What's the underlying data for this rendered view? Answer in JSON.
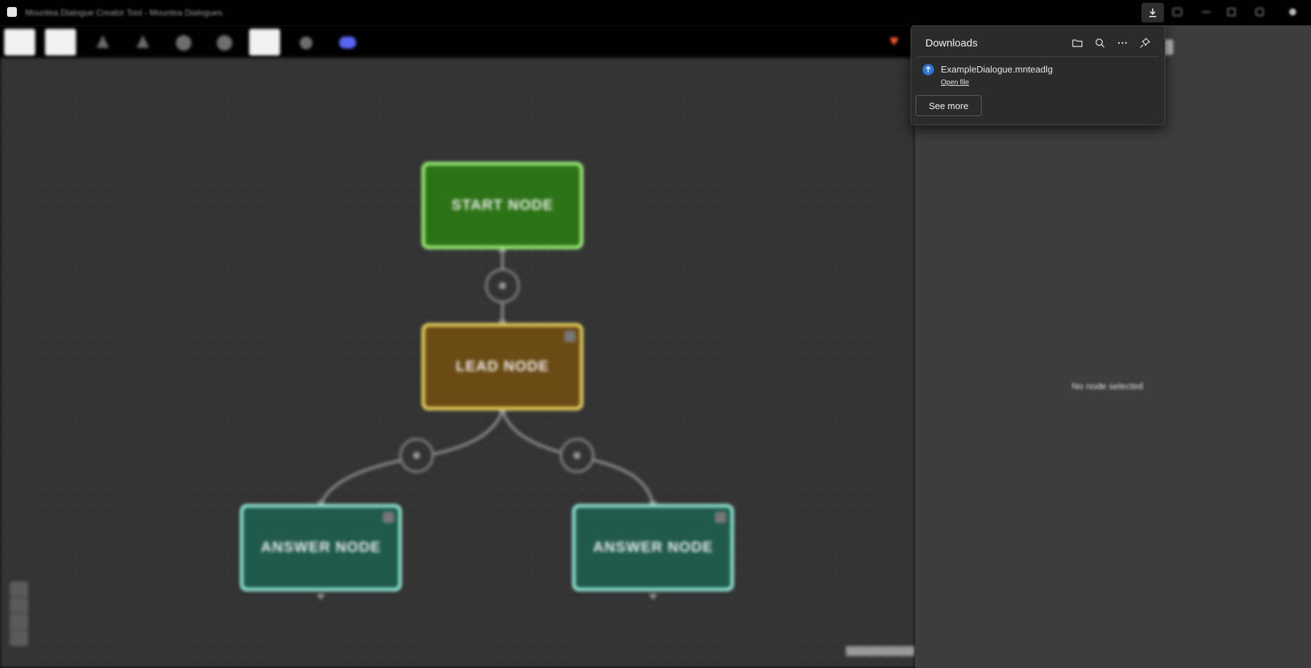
{
  "window": {
    "title": "Mountea Dialogue Creator Tool - Mountea Dialogues"
  },
  "downloads": {
    "title": "Downloads",
    "items": [
      {
        "filename": "ExampleDialogue.mnteadlg",
        "action_label": "Open file"
      }
    ],
    "see_more_label": "See more",
    "header_icons": [
      "folder-icon",
      "search-icon",
      "more-icon",
      "pin-icon"
    ]
  },
  "graph": {
    "nodes": [
      {
        "id": "start",
        "label": "START NODE"
      },
      {
        "id": "lead",
        "label": "LEAD NODE"
      },
      {
        "id": "answer-1",
        "label": "ANSWER NODE"
      },
      {
        "id": "answer-2",
        "label": "ANSWER NODE"
      }
    ]
  },
  "properties_panel": {
    "empty_text": "No node selected"
  },
  "colors": {
    "start_node": "#2b7314",
    "lead_node": "#6b4b14",
    "answer_node": "#1f5a4c",
    "canvas": "#333333",
    "panel": "#3d3d3d"
  }
}
